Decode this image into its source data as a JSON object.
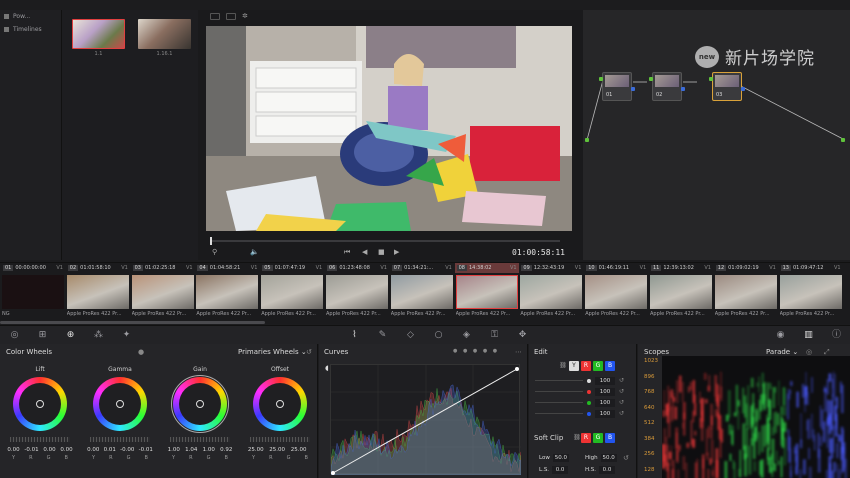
{
  "gallery": {
    "side_items": [
      "Pow...",
      "Timelines"
    ],
    "stills": [
      {
        "label": "1.1",
        "selected": true
      },
      {
        "label": "1.16.1",
        "selected": false
      }
    ]
  },
  "viewer": {
    "timecode": "01:00:58:11"
  },
  "nodes": [
    {
      "label": "01"
    },
    {
      "label": "02"
    },
    {
      "label": "03"
    }
  ],
  "watermark": {
    "logo": "new",
    "text": "新片场学院"
  },
  "clips": [
    {
      "num": "01",
      "tc": "00:00:00:00",
      "track": "V1",
      "name": "NG",
      "color": "#3a2226"
    },
    {
      "num": "02",
      "tc": "01:01:58:10",
      "track": "V1",
      "name": "Apple ProRes 422 Pr...",
      "color": "#a78a6a"
    },
    {
      "num": "03",
      "tc": "01:02:25:18",
      "track": "V1",
      "name": "Apple ProRes 422 Pr...",
      "color": "#b99278"
    },
    {
      "num": "04",
      "tc": "01:04:58:21",
      "track": "V1",
      "name": "Apple ProRes 422 Pr...",
      "color": "#8b7462"
    },
    {
      "num": "05",
      "tc": "01:07:47:19",
      "track": "V1",
      "name": "Apple ProRes 422 Pr...",
      "color": "#a3a39a"
    },
    {
      "num": "06",
      "tc": "01:23:48:08",
      "track": "V1",
      "name": "Apple ProRes 422 Pr...",
      "color": "#9c9c95"
    },
    {
      "num": "07",
      "tc": "01:34:21:...",
      "track": "V1",
      "name": "Apple ProRes 422 Pr...",
      "color": "#8f9aa1"
    },
    {
      "num": "08",
      "tc": "14:38:02",
      "track": "V1",
      "name": "Apple ProRes 422 Pr...",
      "color": "#a7858a"
    },
    {
      "num": "09",
      "tc": "12:32:43:19",
      "track": "V1",
      "name": "Apple ProRes 422 Pr...",
      "color": "#9da7a0"
    },
    {
      "num": "10",
      "tc": "01:46:19:11",
      "track": "V1",
      "name": "Apple ProRes 422 Pr...",
      "color": "#a59085"
    },
    {
      "num": "11",
      "tc": "12:39:13:02",
      "track": "V1",
      "name": "Apple ProRes 422 Pr...",
      "color": "#8f9891"
    },
    {
      "num": "12",
      "tc": "01:09:02:19",
      "track": "V1",
      "name": "Apple ProRes 422 Pr...",
      "color": "#9b8a80"
    },
    {
      "num": "13",
      "tc": "01:09:47:12",
      "track": "V1",
      "name": "Apple ProRes 422 Pr...",
      "color": "#98a09c"
    }
  ],
  "color_wheels": {
    "title": "Color Wheels",
    "mode": "Primaries Wheels",
    "wheels": [
      {
        "label": "Lift",
        "values": [
          "0.00",
          "-0.01",
          "0.00",
          "0.00"
        ]
      },
      {
        "label": "Gamma",
        "values": [
          "0.00",
          "0.01",
          "-0.00",
          "-0.01"
        ]
      },
      {
        "label": "Gain",
        "values": [
          "1.00",
          "1.04",
          "1.00",
          "0.92"
        ]
      },
      {
        "label": "Offset",
        "values": [
          "25.00",
          "25.00",
          "25.00",
          ""
        ]
      }
    ],
    "channel_letters": [
      "Y",
      "R",
      "G",
      "B"
    ]
  },
  "curves": {
    "title": "Curves"
  },
  "edit": {
    "title": "Edit",
    "buttons": [
      "Y",
      "R",
      "G",
      "B"
    ],
    "values": [
      "100",
      "100",
      "100",
      "100"
    ],
    "soft_clip": {
      "title": "Soft Clip",
      "low_label": "Low",
      "low": "50.0",
      "high_label": "High",
      "high": "50.0",
      "ls_label": "L.S.",
      "ls": "0.0",
      "hs_label": "H.S.",
      "hs": "0.0"
    }
  },
  "scopes": {
    "title": "Scopes",
    "mode": "Parade",
    "scale": [
      "1023",
      "896",
      "768",
      "640",
      "512",
      "384",
      "256",
      "128"
    ]
  },
  "colors": {
    "accent": "#d9a23a",
    "selected_clip": "#e14040",
    "red": "#e33",
    "green": "#2b2",
    "blue": "#25e"
  }
}
